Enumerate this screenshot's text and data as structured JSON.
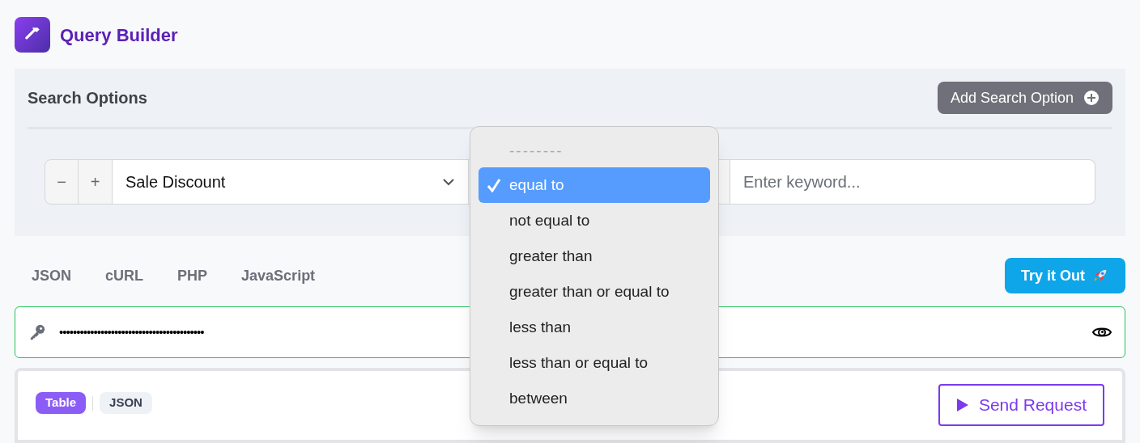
{
  "header": {
    "title": "Query Builder"
  },
  "search_options": {
    "title": "Search Options",
    "add_button": "Add Search Option",
    "row": {
      "minus": "−",
      "plus": "+",
      "field": "Sale Discount",
      "keyword_placeholder": "Enter keyword..."
    }
  },
  "operator_menu": {
    "options": [
      {
        "label": "--------",
        "kind": "placeholder",
        "selected": false
      },
      {
        "label": "equal to",
        "kind": "option",
        "selected": true
      },
      {
        "label": "not equal to",
        "kind": "option",
        "selected": false
      },
      {
        "label": "greater than",
        "kind": "option",
        "selected": false
      },
      {
        "label": "greater than or equal to",
        "kind": "option",
        "selected": false
      },
      {
        "label": "less than",
        "kind": "option",
        "selected": false
      },
      {
        "label": "less than or equal to",
        "kind": "option",
        "selected": false
      },
      {
        "label": "between",
        "kind": "option",
        "selected": false
      }
    ]
  },
  "code_tabs": [
    "JSON",
    "cURL",
    "PHP",
    "JavaScript"
  ],
  "try_button": "Try it Out",
  "api_key": {
    "value": "••••••••••••••••••••••••••••••••••••••••••"
  },
  "result": {
    "views": [
      {
        "label": "Table",
        "selected": true
      },
      {
        "label": "JSON",
        "selected": false
      }
    ],
    "send_button": "Send Request"
  }
}
